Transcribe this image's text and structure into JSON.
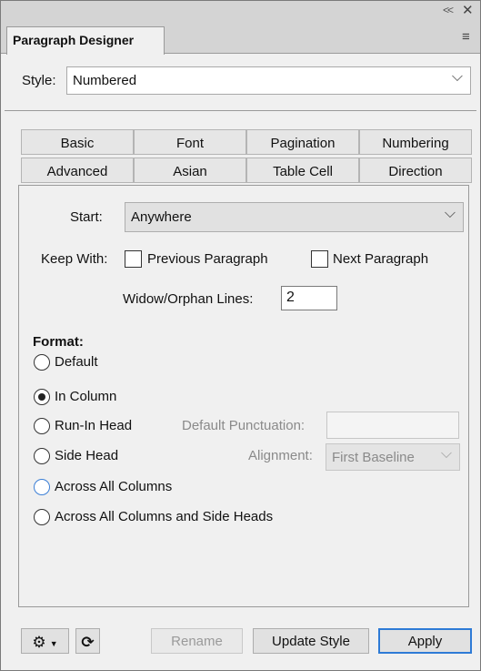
{
  "window": {
    "collapse_icon": "double-chevron-left-icon",
    "close_icon": "close-icon",
    "menu_icon": "hamburger-menu-icon"
  },
  "panel_tab": {
    "label": "Paragraph Designer"
  },
  "style": {
    "label": "Style:",
    "value": "Numbered"
  },
  "tabs": [
    {
      "label": "Basic"
    },
    {
      "label": "Font"
    },
    {
      "label": "Pagination"
    },
    {
      "label": "Numbering"
    },
    {
      "label": "Advanced"
    },
    {
      "label": "Asian"
    },
    {
      "label": "Table Cell"
    },
    {
      "label": "Direction"
    }
  ],
  "pagination": {
    "start_label": "Start:",
    "start_value": "Anywhere",
    "keep_with_label": "Keep With:",
    "previous_paragraph": {
      "label": "Previous Paragraph",
      "checked": false
    },
    "next_paragraph": {
      "label": "Next Paragraph",
      "checked": false
    },
    "widow_orphan_label": "Widow/Orphan Lines:",
    "widow_orphan_value": "2",
    "format_label": "Format:",
    "format_options": [
      {
        "label": "Default",
        "selected": false
      },
      {
        "label": "In Column",
        "selected": true
      },
      {
        "label": "Run-In Head",
        "selected": false
      },
      {
        "label": "Side Head",
        "selected": false
      },
      {
        "label": "Across All Columns",
        "selected": false
      },
      {
        "label": "Across All Columns and Side Heads",
        "selected": false
      }
    ],
    "default_punctuation_label": "Default Punctuation:",
    "default_punctuation_value": "",
    "alignment_label": "Alignment:",
    "alignment_value": "First Baseline"
  },
  "buttons": {
    "gear_icon": "gear-icon",
    "refresh_icon": "refresh-icon",
    "rename": "Rename",
    "update_style": "Update Style",
    "apply": "Apply"
  },
  "colors": {
    "accent": "#2e7bd6",
    "panel_bg": "#f0f0f0"
  }
}
